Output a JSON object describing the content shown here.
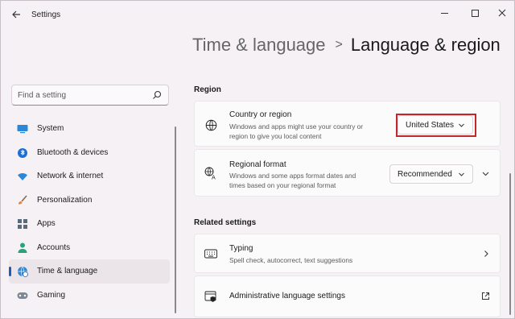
{
  "window": {
    "title": "Settings",
    "back_icon": "back-arrow-icon"
  },
  "breadcrumb": {
    "parent": "Time & language",
    "separator": ">",
    "current": "Language & region"
  },
  "search": {
    "placeholder": "Find a setting"
  },
  "sidebar": {
    "items": [
      {
        "label": "System",
        "icon": "monitor-icon",
        "active": false
      },
      {
        "label": "Bluetooth & devices",
        "icon": "bluetooth-icon",
        "active": false
      },
      {
        "label": "Network & internet",
        "icon": "wifi-icon",
        "active": false
      },
      {
        "label": "Personalization",
        "icon": "paintbrush-icon",
        "active": false
      },
      {
        "label": "Apps",
        "icon": "apps-icon",
        "active": false
      },
      {
        "label": "Accounts",
        "icon": "person-icon",
        "active": false
      },
      {
        "label": "Time & language",
        "icon": "globe-clock-icon",
        "active": true
      },
      {
        "label": "Gaming",
        "icon": "gamepad-icon",
        "active": false
      }
    ]
  },
  "region": {
    "section_title": "Region",
    "country": {
      "title": "Country or region",
      "desc_line1": "Windows and apps might use your country or",
      "desc_line2": "region to give you local content",
      "value": "United States"
    },
    "format": {
      "title": "Regional format",
      "desc_line1": "Windows and some apps format dates and",
      "desc_line2": "times based on your regional format",
      "value": "Recommended"
    }
  },
  "related": {
    "section_title": "Related settings",
    "typing": {
      "title": "Typing",
      "desc": "Spell check, autocorrect, text suggestions"
    },
    "admin": {
      "title": "Administrative language settings"
    }
  },
  "colors": {
    "accent": "#1a5fb4",
    "highlight": "#c1272d"
  }
}
